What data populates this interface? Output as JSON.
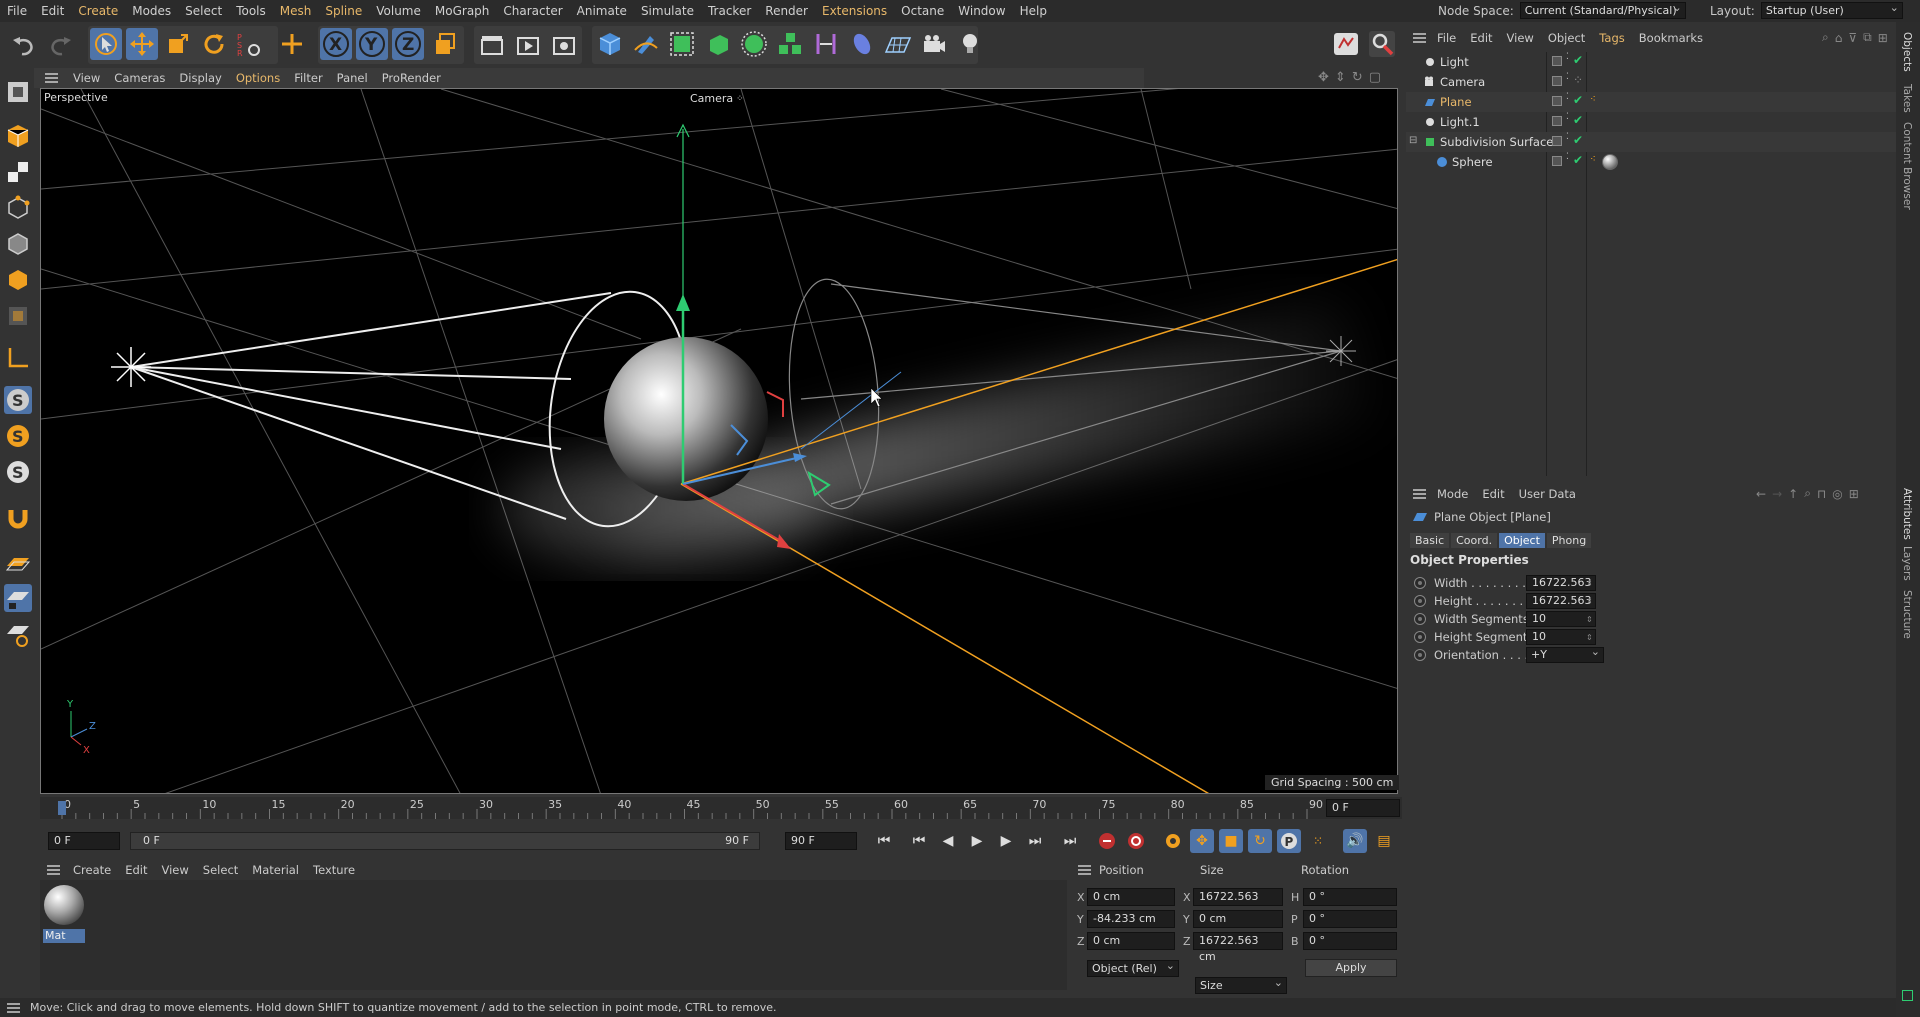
{
  "menubar": {
    "items": [
      "File",
      "Edit",
      "Create",
      "Modes",
      "Select",
      "Tools",
      "Mesh",
      "Spline",
      "Volume",
      "MoGraph",
      "Character",
      "Animate",
      "Simulate",
      "Tracker",
      "Render",
      "Extensions",
      "Octane",
      "Window",
      "Help"
    ],
    "node_space_label": "Node Space:",
    "node_space_value": "Current (Standard/Physical)",
    "layout_label": "Layout:",
    "layout_value": "Startup (User)"
  },
  "viewport_menu": [
    "View",
    "Cameras",
    "Display",
    "Options",
    "Filter",
    "Panel",
    "ProRender"
  ],
  "viewport": {
    "view_name": "Perspective",
    "camera_label": "Camera",
    "grid_spacing": "Grid Spacing : 500 cm"
  },
  "timeline": {
    "ticks": [
      "0",
      "5",
      "10",
      "15",
      "20",
      "25",
      "30",
      "35",
      "40",
      "45",
      "50",
      "55",
      "60",
      "65",
      "70",
      "75",
      "80",
      "85",
      "90"
    ],
    "current_frame": "0 F",
    "start_frame": "0 F",
    "range_start": "0 F",
    "range_end": "90 F",
    "end_frame": "90 F"
  },
  "material_manager": {
    "menu": [
      "Create",
      "Edit",
      "View",
      "Select",
      "Material",
      "Texture"
    ],
    "materials": [
      {
        "name": "Mat"
      }
    ]
  },
  "coordinates": {
    "headers": [
      "Position",
      "Size",
      "Rotation"
    ],
    "rows": [
      {
        "axis": "X",
        "pos": "0 cm",
        "size_axis": "X",
        "size": "16722.563 cm",
        "rot_axis": "H",
        "rot": "0 °"
      },
      {
        "axis": "Y",
        "pos": "-84.233 cm",
        "size_axis": "Y",
        "size": "0 cm",
        "rot_axis": "P",
        "rot": "0 °"
      },
      {
        "axis": "Z",
        "pos": "0 cm",
        "size_axis": "Z",
        "size": "16722.563 cm",
        "rot_axis": "B",
        "rot": "0 °"
      }
    ],
    "mode_value": "Object (Rel)",
    "size_mode_value": "Size",
    "apply_label": "Apply"
  },
  "object_manager": {
    "menu": [
      "File",
      "Edit",
      "View",
      "Object",
      "Tags",
      "Bookmarks"
    ],
    "objects": [
      {
        "name": "Light",
        "indent": 0
      },
      {
        "name": "Camera",
        "indent": 0
      },
      {
        "name": "Plane",
        "indent": 0,
        "selected": true
      },
      {
        "name": "Light.1",
        "indent": 0
      },
      {
        "name": "Subdivision Surface",
        "indent": 0
      },
      {
        "name": "Sphere",
        "indent": 1
      }
    ]
  },
  "attribute_manager": {
    "menu": [
      "Mode",
      "Edit",
      "User Data"
    ],
    "object_title": "Plane Object [Plane]",
    "tabs": [
      "Basic",
      "Coord.",
      "Object",
      "Phong"
    ],
    "active_tab": "Object",
    "section": "Object Properties",
    "props": [
      {
        "label": "Width . . . . . . . .",
        "value": "16722.563 c"
      },
      {
        "label": "Height . . . . . . .",
        "value": "16722.563 c"
      },
      {
        "label": "Width Segments",
        "value": "10"
      },
      {
        "label": "Height Segments",
        "value": "10"
      },
      {
        "label": "Orientation . . . .",
        "value": "+Y"
      }
    ]
  },
  "side_tabs": [
    "Objects",
    "Takes",
    "Content Browser",
    "Attributes",
    "Layers",
    "Structure"
  ],
  "status": "Move: Click and drag to move elements. Hold down SHIFT to quantize movement / add to the selection in point mode, CTRL to remove.",
  "colors": {
    "accent_blue": "#4f74a8",
    "highlight_orange": "#e8b86a",
    "axis_orange": "#f0a020"
  }
}
